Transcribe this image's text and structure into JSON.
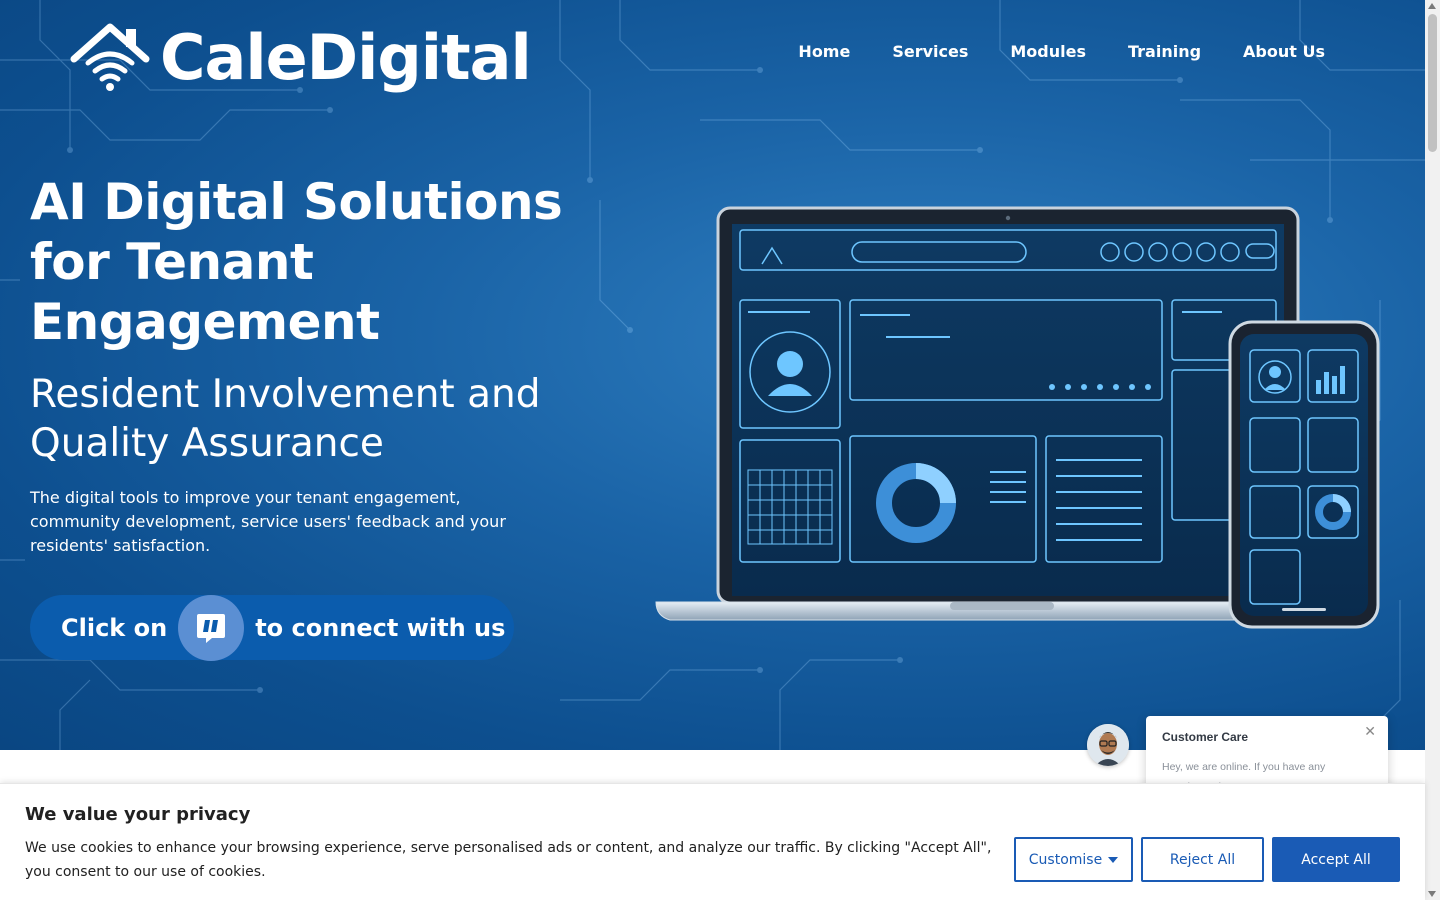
{
  "brand": {
    "name": "CaleDigital"
  },
  "nav": {
    "items": [
      "Home",
      "Services",
      "Modules",
      "Training",
      "About Us"
    ]
  },
  "hero": {
    "headline": "AI Digital Solutions for Tenant Engagement",
    "subheadline": "Resident Involvement and Quality Assurance",
    "description": "The digital tools to improve your tenant engagement, community development,  service users' feedback and your residents' satisfaction.",
    "cta_prefix": "Click on",
    "cta_suffix": "to connect with us",
    "cta_icon": "quote-chat-icon"
  },
  "chat": {
    "title": "Customer Care",
    "message": "Hey, we are online. If you have any questions, please message us"
  },
  "cookie": {
    "title": "We value your privacy",
    "text": "We use cookies to enhance your browsing experience, serve personalised ads or content, and analyze our traffic. By clicking \"Accept All\", you consent to our use of cookies.",
    "customise_label": "Customise",
    "reject_label": "Reject All",
    "accept_label": "Accept All"
  },
  "colors": {
    "hero_bg": "#1a63a6",
    "cta_bg": "#0b5cad",
    "cookie_accent": "#1a5bb5"
  }
}
